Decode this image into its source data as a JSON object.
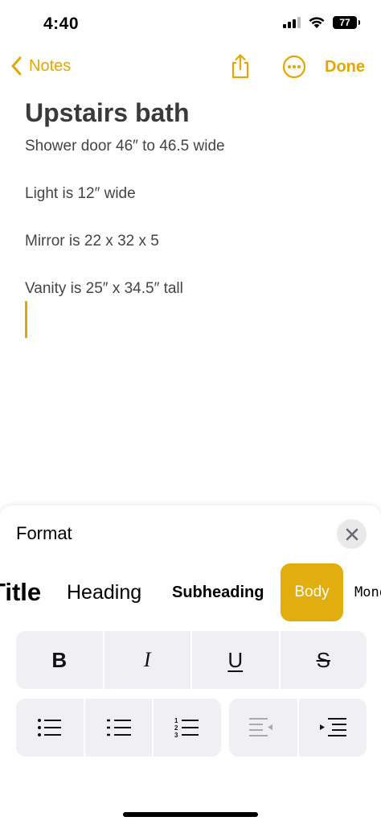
{
  "status": {
    "time": "4:40",
    "battery": "77"
  },
  "nav": {
    "back_label": "Notes",
    "done_label": "Done"
  },
  "note": {
    "title": "Upstairs bath",
    "lines": [
      "Shower door 46″ to 46.5 wide",
      "Light is 12″ wide",
      "Mirror is 22 x 32 x 5",
      "Vanity is 25″ x 34.5″ tall"
    ]
  },
  "format": {
    "title": "Format",
    "styles": [
      "Title",
      "Heading",
      "Subheading",
      "Body",
      "Monostyled"
    ],
    "selected_style": "Body",
    "text_buttons": [
      "B",
      "I",
      "U",
      "S"
    ]
  },
  "icons": {
    "back": "chevron-left-icon",
    "share": "share-icon",
    "more": "ellipsis-circle-icon",
    "close": "close-icon",
    "bulleted": "bulleted-list-icon",
    "dashed": "dashed-list-icon",
    "numbered": "numbered-list-icon",
    "outdent": "decrease-indent-icon",
    "indent": "increase-indent-icon"
  },
  "colors": {
    "accent": "#e2a700",
    "selected_style_bg": "#e2ad0f",
    "button_bg": "#efeff4"
  }
}
